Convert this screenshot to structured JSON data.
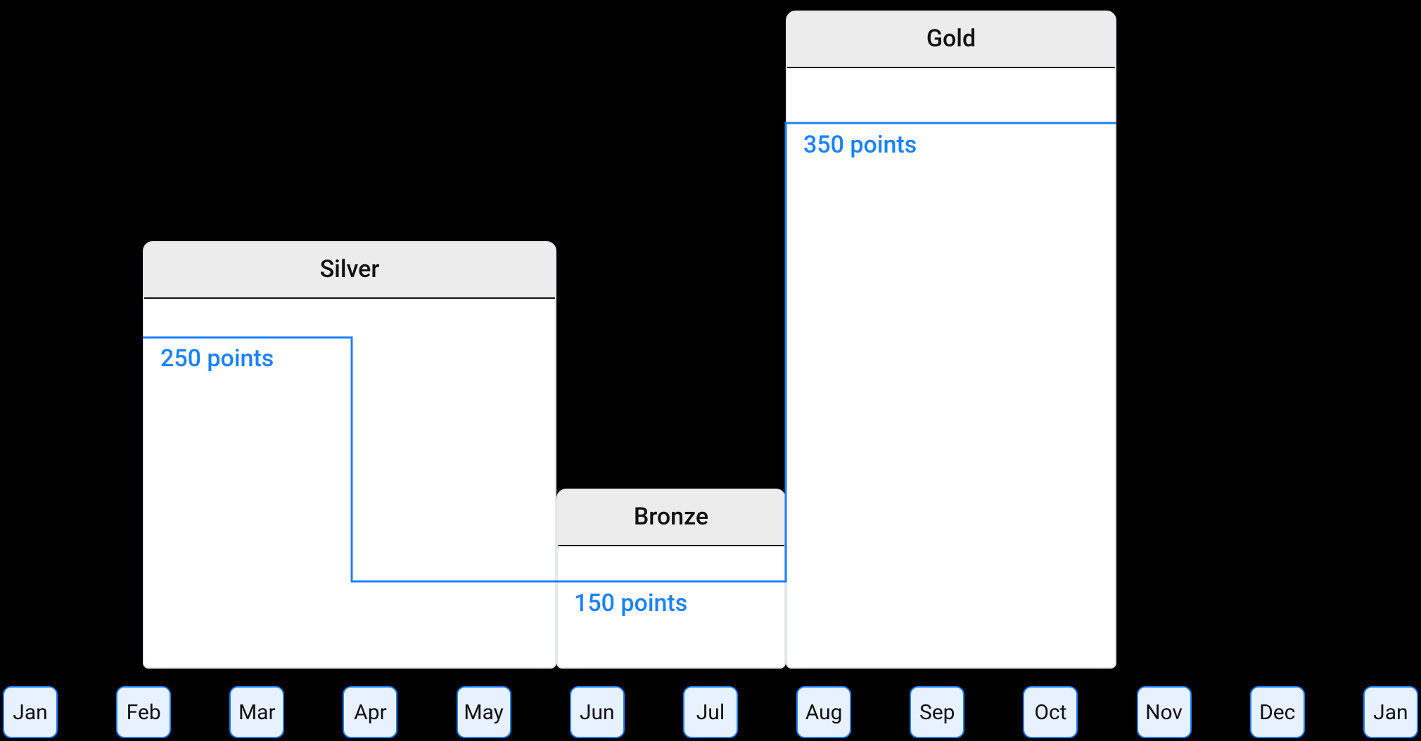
{
  "chart_data": {
    "type": "bar",
    "categories": [
      "Jan",
      "Feb",
      "Mar",
      "Apr",
      "May",
      "Jun",
      "Jul",
      "Aug",
      "Sep",
      "Oct",
      "Nov",
      "Dec",
      "Jan"
    ],
    "series": [
      {
        "name": "tier",
        "values": [
          "Silver",
          "Silver",
          "Silver",
          "Silver",
          "Bronze",
          "Bronze",
          "Gold",
          "Gold",
          "Gold",
          "Gold",
          "Gold"
        ],
        "span_start": 1,
        "span_end": 11
      },
      {
        "name": "points",
        "values": [
          250,
          250,
          150,
          150,
          150,
          150,
          350,
          350,
          350,
          350,
          350
        ],
        "span_start": 1,
        "span_end": 11
      }
    ],
    "title": "",
    "xlabel": "",
    "ylabel": "",
    "ylim": [
      0,
      400
    ]
  },
  "tiers": {
    "silver": {
      "title": "Silver",
      "points_label": "250 points"
    },
    "bronze": {
      "title": "Bronze",
      "points_label": "150 points"
    },
    "gold": {
      "title": "Gold",
      "points_label": "350 points"
    }
  },
  "months": [
    "Jan",
    "Feb",
    "Mar",
    "Apr",
    "May",
    "Jun",
    "Jul",
    "Aug",
    "Sep",
    "Oct",
    "Nov",
    "Dec",
    "Jan"
  ]
}
